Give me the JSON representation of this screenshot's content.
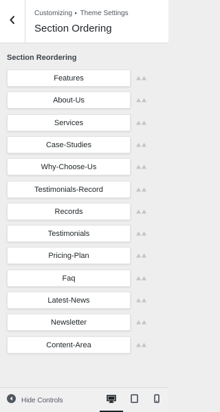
{
  "header": {
    "breadcrumb_root": "Customizing",
    "breadcrumb_separator": "▸",
    "breadcrumb_current": "Theme Settings",
    "title": "Section Ordering",
    "back_icon": "chevron-left-icon"
  },
  "section": {
    "heading": "Section Reordering",
    "items": [
      {
        "label": "Features"
      },
      {
        "label": "About-Us"
      },
      {
        "label": "Services"
      },
      {
        "label": "Case-Studies"
      },
      {
        "label": "Why-Choose-Us"
      },
      {
        "label": "Testimonials-Record"
      },
      {
        "label": "Records"
      },
      {
        "label": "Testimonials"
      },
      {
        "label": "Pricing-Plan"
      },
      {
        "label": "Faq"
      },
      {
        "label": "Latest-News"
      },
      {
        "label": "Newsletter"
      },
      {
        "label": "Content-Area"
      }
    ]
  },
  "footer": {
    "hide_controls_label": "Hide Controls",
    "devices": [
      "desktop-icon",
      "tablet-icon",
      "mobile-icon"
    ],
    "active_device": "desktop"
  },
  "colors": {
    "background": "#eeeeee",
    "panel": "#ffffff",
    "text": "#1d2327",
    "muted_text": "#50575e",
    "arrow": "#c3c4c7",
    "border": "#dcdcde"
  }
}
